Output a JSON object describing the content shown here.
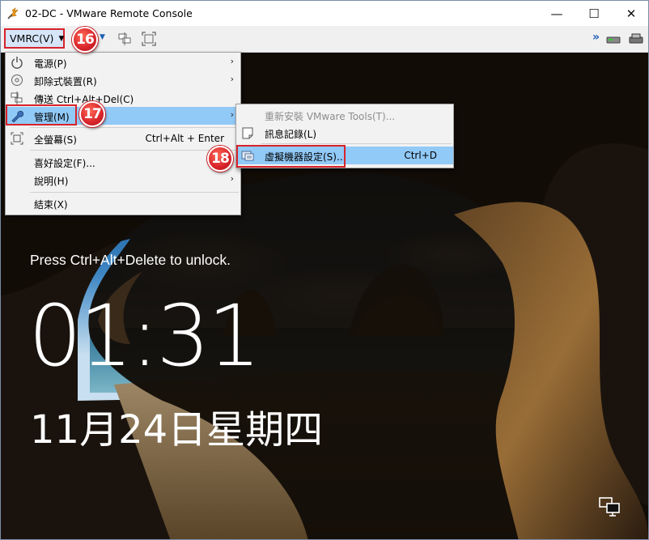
{
  "window": {
    "title": "02-DC - VMware Remote Console",
    "minimize_glyph": "—",
    "maximize_glyph": "☐",
    "close_glyph": "✕"
  },
  "toolbar": {
    "vmrc_label": "VMRC(V)",
    "vmrc_caret": "▼",
    "small_caret": "▼",
    "more_glyph": "»",
    "icons": [
      "send-ctrl-alt-del-icon",
      "full-screen-icon",
      "removable-drive-icon",
      "network-adapter-icon"
    ]
  },
  "annotations": {
    "badge_16": "16",
    "badge_17": "17",
    "badge_18": "18",
    "highlight_color": "#d8232a"
  },
  "main_menu": {
    "items": [
      {
        "label": "電源(P)",
        "icon": "power-icon",
        "submenu": true
      },
      {
        "label": "卸除式裝置(R)",
        "icon": "disc-icon",
        "submenu": true
      },
      {
        "label": "傳送 Ctrl+Alt+Del(C)",
        "icon": "send-keys-icon",
        "submenu": false
      },
      {
        "label": "管理(M)",
        "icon": "wrench-icon",
        "submenu": true,
        "highlighted": true
      },
      {
        "label": "全螢幕(S)",
        "icon": "full-screen-icon",
        "accelerator": "Ctrl+Alt + Enter"
      },
      {
        "label": "喜好設定(F)..."
      },
      {
        "label": "說明(H)",
        "submenu": true
      },
      {
        "label": "結束(X)"
      }
    ],
    "arrow_glyph": "›"
  },
  "manage_submenu": {
    "items": [
      {
        "label": "重新安裝 VMware Tools(T)...",
        "disabled": true
      },
      {
        "label": "訊息記錄(L)",
        "icon": "message-log-icon"
      },
      {
        "label": "虛擬機器設定(S)...",
        "icon": "vm-settings-icon",
        "accelerator": "Ctrl+D",
        "highlighted": true
      }
    ]
  },
  "lock_screen": {
    "message": "Press Ctrl+Alt+Delete to unlock.",
    "time": "01:31",
    "date": "11月24日星期四"
  },
  "colors": {
    "menu_highlight": "#91c9f7",
    "vmrc_button_bg": "#d6e5f8",
    "accent_blue": "#1e5fb4"
  }
}
